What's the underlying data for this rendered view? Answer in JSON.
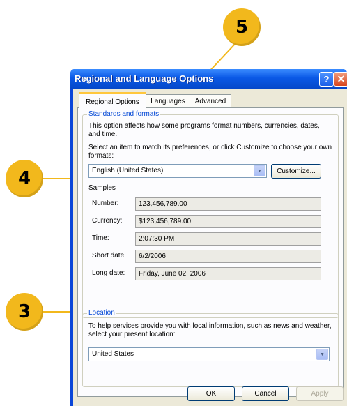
{
  "callouts": {
    "c5": "5",
    "c4": "4",
    "c3": "3"
  },
  "window": {
    "title": "Regional and Language Options",
    "help": "?",
    "close": "✕"
  },
  "tabs": [
    "Regional Options",
    "Languages",
    "Advanced"
  ],
  "standards": {
    "label": "Standards and formats",
    "description": "This option affects how some programs format numbers, currencies, dates, and time.",
    "instruction": "Select an item to match its preferences, or click Customize to choose your own formats:",
    "selected": "English (United States)",
    "customize_label": "Customize...",
    "samples_label": "Samples",
    "samples": [
      {
        "label": "Number:",
        "value": "123,456,789.00"
      },
      {
        "label": "Currency:",
        "value": "$123,456,789.00"
      },
      {
        "label": "Time:",
        "value": "2:07:30 PM"
      },
      {
        "label": "Short date:",
        "value": "6/2/2006"
      },
      {
        "label": "Long date:",
        "value": "Friday, June 02, 2006"
      }
    ]
  },
  "location": {
    "label": "Location",
    "description": "To help services provide you with local information, such as news and weather, select your present location:",
    "selected": "United States"
  },
  "footer": {
    "ok": "OK",
    "cancel": "Cancel",
    "apply": "Apply"
  },
  "colors": {
    "callout": "#f2b81c",
    "titlebar": "#0a58e6",
    "group_label": "#0046d5"
  }
}
